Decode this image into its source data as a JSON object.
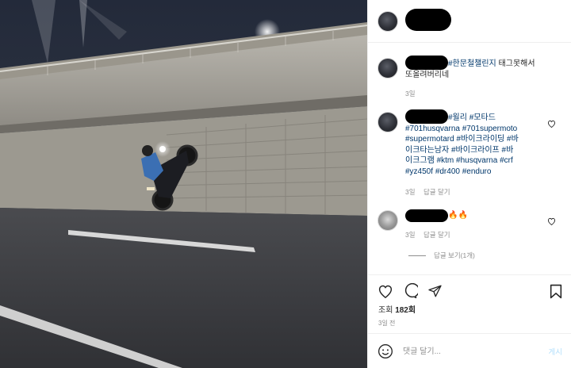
{
  "header": {
    "username_hidden": true
  },
  "comments": [
    {
      "username_hidden": true,
      "text_lines": [
        [
          {
            "t": "#한문철챌린지",
            "tag": true
          },
          {
            "t": " 태그못해서",
            "tag": false
          }
        ],
        [
          {
            "t": "또올려버리네",
            "tag": false
          }
        ]
      ],
      "time": "3일",
      "reply": ""
    },
    {
      "username_hidden": true,
      "text_lines": [
        [
          {
            "t": "#윌리",
            "tag": true
          },
          {
            "t": " ",
            "tag": false
          },
          {
            "t": "#모타드",
            "tag": true
          }
        ],
        [
          {
            "t": "#701husqvarna",
            "tag": true
          },
          {
            "t": " ",
            "tag": false
          },
          {
            "t": "#701supermoto",
            "tag": true
          }
        ],
        [
          {
            "t": "#supermotard",
            "tag": true
          },
          {
            "t": " ",
            "tag": false
          },
          {
            "t": "#바이크라이딩",
            "tag": true
          },
          {
            "t": " ",
            "tag": false
          },
          {
            "t": "#바",
            "tag": true
          }
        ],
        [
          {
            "t": "이크타는남자",
            "tag": true
          },
          {
            "t": " ",
            "tag": false
          },
          {
            "t": "#바이크라이프",
            "tag": true
          },
          {
            "t": " ",
            "tag": false
          },
          {
            "t": "#바",
            "tag": true
          }
        ],
        [
          {
            "t": "이크그램",
            "tag": true
          },
          {
            "t": " ",
            "tag": false
          },
          {
            "t": "#ktm",
            "tag": true
          },
          {
            "t": " ",
            "tag": false
          },
          {
            "t": "#husqvarna",
            "tag": true
          },
          {
            "t": " ",
            "tag": false
          },
          {
            "t": "#crf",
            "tag": true
          }
        ],
        [
          {
            "t": "#yz450f",
            "tag": true
          },
          {
            "t": " ",
            "tag": false
          },
          {
            "t": "#dr400",
            "tag": true
          },
          {
            "t": " ",
            "tag": false
          },
          {
            "t": "#enduro",
            "tag": true
          }
        ]
      ],
      "time": "3일",
      "reply": "답글 달기"
    },
    {
      "username_hidden": true,
      "emoji": "🔥🔥",
      "time": "3일",
      "reply": "답글 달기"
    }
  ],
  "view_replies": "답글 보기(1개)",
  "views": {
    "label": "조회",
    "count": "182회"
  },
  "posted_ago": "3일 전",
  "comment_box": {
    "placeholder": "댓글 달기...",
    "post_label": "게시"
  },
  "icons": [
    "heart-icon",
    "comment-icon",
    "share-icon",
    "bookmark-icon",
    "emoji-icon"
  ],
  "colors": {
    "hashtag": "#00376b",
    "muted": "#8e8e8e",
    "post_disabled": "#b2dffc"
  }
}
